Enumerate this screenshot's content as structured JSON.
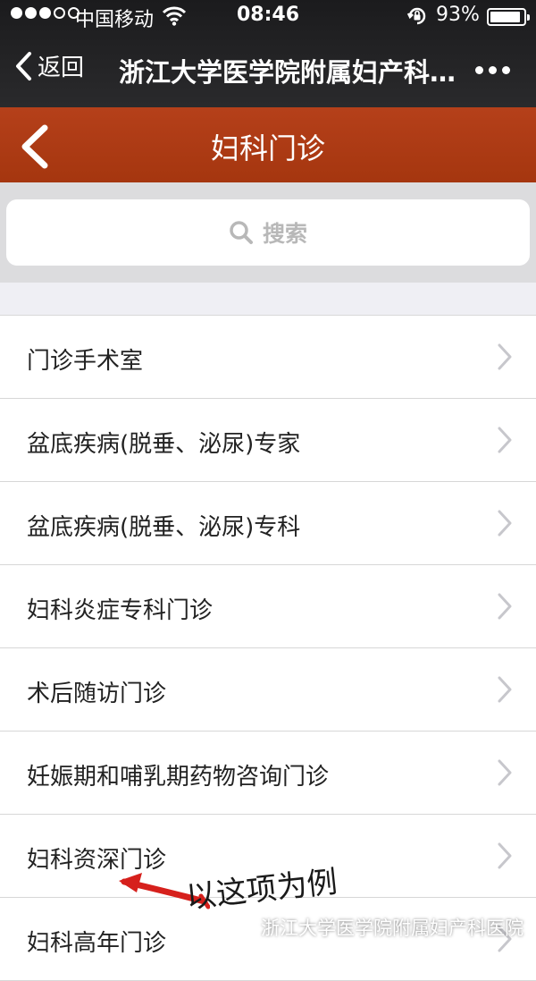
{
  "status_bar": {
    "carrier": "中国移动",
    "time": "08:46",
    "battery": "93%",
    "battery_level": 0.93
  },
  "wechat_nav": {
    "back_label": "返回",
    "title": "浙江大学医学院附属妇产科医院"
  },
  "page": {
    "title": "妇科门诊"
  },
  "search": {
    "placeholder": "搜索"
  },
  "list": {
    "items": [
      "门诊手术室",
      "盆底疾病(脱垂、泌尿)专家",
      "盆底疾病(脱垂、泌尿)专科",
      "妇科炎症专科门诊",
      "术后随访门诊",
      "妊娠期和哺乳期药物咨询门诊",
      "妇科资深门诊",
      "妇科高年门诊"
    ]
  },
  "annotation": {
    "text": "以这项为例"
  },
  "watermark": {
    "text": "浙江大学医学院附属妇产科医院"
  },
  "colors": {
    "header_brown": "#a83a13",
    "annotation_red": "#d6201c"
  }
}
